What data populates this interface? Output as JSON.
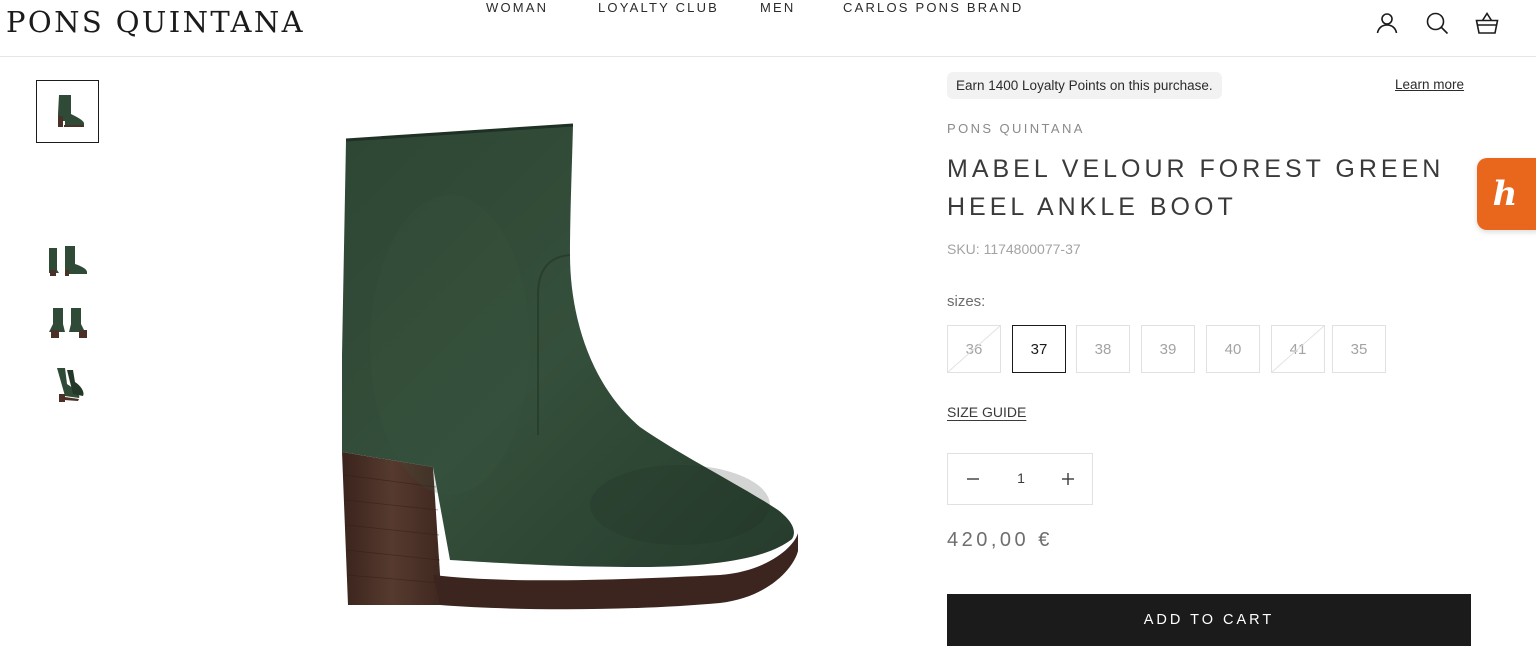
{
  "header": {
    "logo": "PONS QUINTANA",
    "nav": [
      "WOMAN",
      "LOYALTY CLUB",
      "MEN",
      "CARLOS PONS BRAND"
    ],
    "icons": [
      "account-icon",
      "search-icon",
      "cart-icon"
    ]
  },
  "gallery": {
    "thumbnails": [
      "boot-side-view",
      "boot-pair-front",
      "boot-pair-back",
      "boot-pair-angle"
    ],
    "active_index": 0
  },
  "product": {
    "loyalty_text": "Earn 1400 Loyalty Points on this purchase.",
    "learn_more": "Learn more",
    "brand": "PONS QUINTANA",
    "title": "MABEL VELOUR FOREST GREEN HEEL ANKLE BOOT",
    "sku_label": "SKU:",
    "sku": "1174800077-37",
    "sizes_label": "sizes:",
    "sizes": [
      {
        "label": "36",
        "available": false,
        "selected": false
      },
      {
        "label": "37",
        "available": true,
        "selected": true
      },
      {
        "label": "38",
        "available": true,
        "selected": false
      },
      {
        "label": "39",
        "available": true,
        "selected": false
      },
      {
        "label": "40",
        "available": true,
        "selected": false
      },
      {
        "label": "41",
        "available": false,
        "selected": false
      },
      {
        "label": "35",
        "available": true,
        "selected": false
      }
    ],
    "size_guide": "SIZE GUIDE",
    "quantity": "1",
    "price": "420,00 €",
    "add_to_cart": "ADD TO CART"
  },
  "honey_widget": {
    "glyph": "h"
  },
  "colors": {
    "boot_suede": "#2f4a36",
    "heel_wood": "#4a3026",
    "button_bg": "#1c1b1b",
    "honey_orange": "#e8671c"
  }
}
